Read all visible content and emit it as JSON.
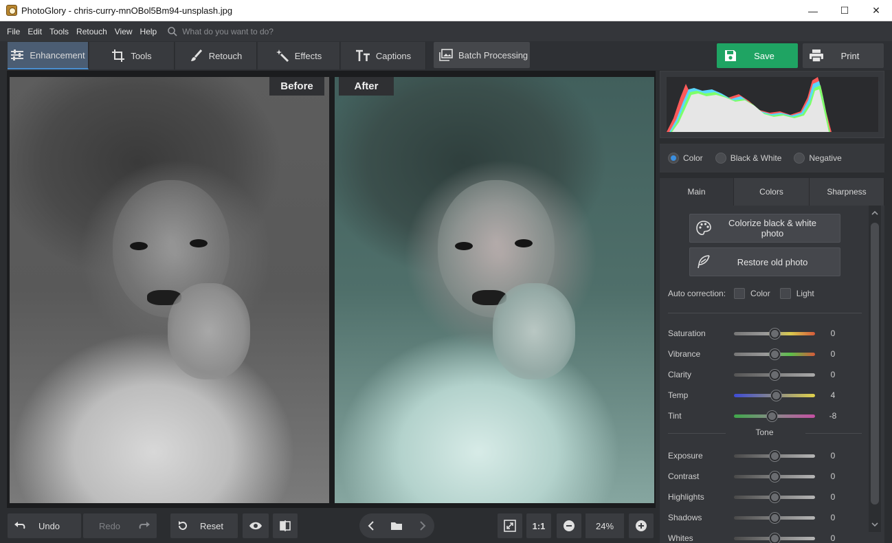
{
  "window": {
    "title": "PhotoGlory - chris-curry-mnOBol5Bm94-unsplash.jpg",
    "minimize": "—",
    "maximize": "☐",
    "close": "✕"
  },
  "menu": {
    "items": [
      "File",
      "Edit",
      "Tools",
      "Retouch",
      "View",
      "Help"
    ],
    "search_placeholder": "What do you want to do?"
  },
  "tabs": [
    {
      "label": "Enhancement",
      "icon": "sliders-icon",
      "active": true
    },
    {
      "label": "Tools",
      "icon": "crop-icon",
      "active": false
    },
    {
      "label": "Retouch",
      "icon": "brush-icon",
      "active": false
    },
    {
      "label": "Effects",
      "icon": "magic-wand-icon",
      "active": false
    },
    {
      "label": "Captions",
      "icon": "text-icon",
      "active": false
    }
  ],
  "batch": {
    "label": "Batch Processing",
    "icon": "images-icon"
  },
  "save": {
    "label": "Save",
    "color": "#1fa463"
  },
  "print": {
    "label": "Print"
  },
  "viewer": {
    "before_label": "Before",
    "after_label": "After"
  },
  "bottom": {
    "undo": "Undo",
    "redo": "Redo",
    "reset": "Reset",
    "actual_size": "1:1",
    "zoom": "24%"
  },
  "side": {
    "modes": [
      {
        "label": "Color",
        "selected": true
      },
      {
        "label": "Black & White",
        "selected": false
      },
      {
        "label": "Negative",
        "selected": false
      }
    ],
    "subtabs": [
      "Main",
      "Colors",
      "Sharpness"
    ],
    "colorize_label": "Colorize black & white photo",
    "restore_label": "Restore old photo",
    "auto_correction_label": "Auto correction:",
    "auto_color_label": "Color",
    "auto_light_label": "Light",
    "tone_title": "Tone",
    "sliders": [
      {
        "label": "Saturation",
        "value": "0"
      },
      {
        "label": "Vibrance",
        "value": "0"
      },
      {
        "label": "Clarity",
        "value": "0"
      },
      {
        "label": "Temp",
        "value": "4"
      },
      {
        "label": "Tint",
        "value": "-8"
      },
      {
        "label": "Exposure",
        "value": "0"
      },
      {
        "label": "Contrast",
        "value": "0"
      },
      {
        "label": "Highlights",
        "value": "0"
      },
      {
        "label": "Shadows",
        "value": "0"
      },
      {
        "label": "Whites",
        "value": "0"
      }
    ]
  }
}
